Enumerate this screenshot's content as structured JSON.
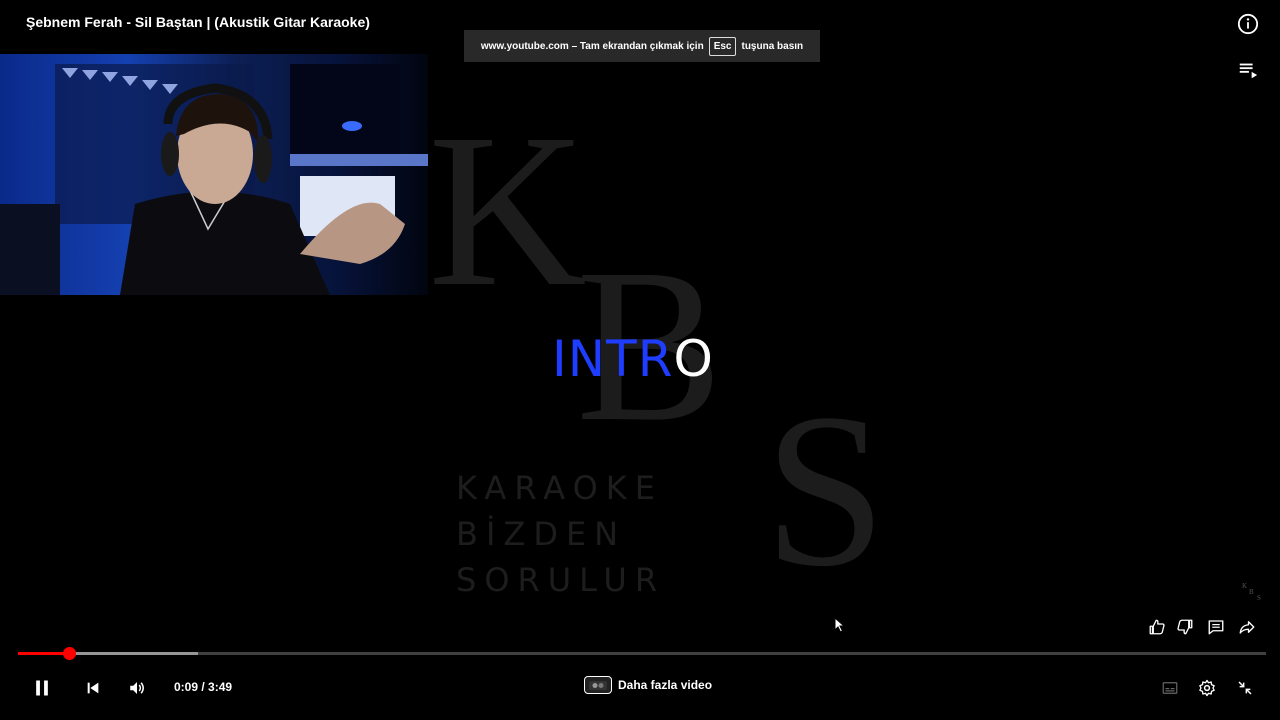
{
  "video": {
    "title": "Şebnem Ferah - Sil Baştan | (Akustik Gitar Karaoke)",
    "overlay_text": {
      "blue": "INTR",
      "white": "O"
    },
    "watermark": {
      "letters": [
        "K",
        "B",
        "S"
      ],
      "words": [
        "KARAOKE",
        "BİZDEN",
        "SORULUR"
      ]
    }
  },
  "fullscreen_notice": {
    "prefix": "www.youtube.com – Tam ekrandan çıkmak için",
    "key": "Esc",
    "suffix": "tuşuna basın"
  },
  "player": {
    "current_time": "0:09 / 3:49",
    "progress_fraction": 0.041,
    "buffered_fraction": 0.144,
    "more_videos_label": "Daha fazla video"
  },
  "icons": {
    "info": "info-icon",
    "queue": "playlist-icon",
    "like": "thumbs-up-icon",
    "dislike": "thumbs-down-icon",
    "comments": "comment-icon",
    "share": "share-icon",
    "pause": "pause-icon",
    "previous": "skip-previous-icon",
    "volume": "volume-icon",
    "subtitles": "subtitles-icon",
    "settings": "gear-icon",
    "exit_fullscreen": "exit-fullscreen-icon"
  },
  "colors": {
    "progress": "#ff0000",
    "intro_blue": "#1e3dff",
    "background": "#000000"
  }
}
